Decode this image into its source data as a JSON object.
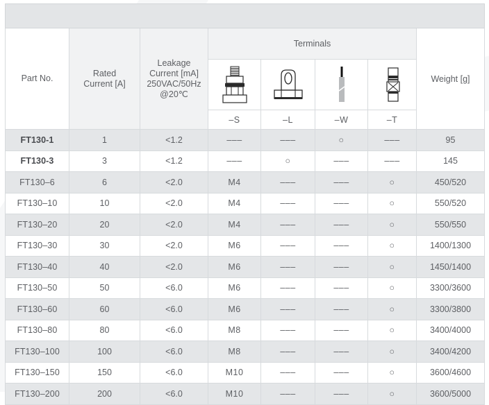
{
  "table": {
    "headers": {
      "part_no": "Part No.",
      "rated_current": "Rated\nCurrent [A]",
      "rated_current_line1": "Rated",
      "rated_current_line2": "Current [A]",
      "leakage_line1": "Leakage",
      "leakage_line2": "Current [mA]",
      "leakage_line3": "250VAC/50Hz",
      "leakage_line4": "@20℃",
      "terminals": "Terminals",
      "weight": "Weight [g]"
    },
    "terminal_types": [
      {
        "code": "–S",
        "icon": "screw-terminal-icon"
      },
      {
        "code": "–L",
        "icon": "lug-terminal-icon"
      },
      {
        "code": "–W",
        "icon": "wire-terminal-icon"
      },
      {
        "code": "–T",
        "icon": "tab-terminal-icon"
      }
    ],
    "rows": [
      {
        "part_no": "FT130-1",
        "bold": true,
        "rated_current": "1",
        "leakage": "<1.2",
        "s": "‒‒‒",
        "l": "‒‒‒",
        "w": "○",
        "t": "‒‒‒",
        "weight": "95"
      },
      {
        "part_no": "FT130-3",
        "bold": true,
        "rated_current": "3",
        "leakage": "<1.2",
        "s": "‒‒‒",
        "l": "○",
        "w": "‒‒‒",
        "t": "‒‒‒",
        "weight": "145"
      },
      {
        "part_no": "FT130–6",
        "bold": false,
        "rated_current": "6",
        "leakage": "<2.0",
        "s": "M4",
        "l": "‒‒‒",
        "w": "‒‒‒",
        "t": "○",
        "weight": "450/520"
      },
      {
        "part_no": "FT130–10",
        "bold": false,
        "rated_current": "10",
        "leakage": "<2.0",
        "s": "M4",
        "l": "‒‒‒",
        "w": "‒‒‒",
        "t": "○",
        "weight": "550/520"
      },
      {
        "part_no": "FT130–20",
        "bold": false,
        "rated_current": "20",
        "leakage": "<2.0",
        "s": "M4",
        "l": "‒‒‒",
        "w": "‒‒‒",
        "t": "○",
        "weight": "550/550"
      },
      {
        "part_no": "FT130–30",
        "bold": false,
        "rated_current": "30",
        "leakage": "<2.0",
        "s": "M6",
        "l": "‒‒‒",
        "w": "‒‒‒",
        "t": "○",
        "weight": "1400/1300"
      },
      {
        "part_no": "FT130–40",
        "bold": false,
        "rated_current": "40",
        "leakage": "<2.0",
        "s": "M6",
        "l": "‒‒‒",
        "w": "‒‒‒",
        "t": "○",
        "weight": "1450/1400"
      },
      {
        "part_no": "FT130–50",
        "bold": false,
        "rated_current": "50",
        "leakage": "<6.0",
        "s": "M6",
        "l": "‒‒‒",
        "w": "‒‒‒",
        "t": "○",
        "weight": "3300/3600"
      },
      {
        "part_no": "FT130–60",
        "bold": false,
        "rated_current": "60",
        "leakage": "<6.0",
        "s": "M6",
        "l": "‒‒‒",
        "w": "‒‒‒",
        "t": "○",
        "weight": "3300/3800"
      },
      {
        "part_no": "FT130–80",
        "bold": false,
        "rated_current": "80",
        "leakage": "<6.0",
        "s": "M8",
        "l": "‒‒‒",
        "w": "‒‒‒",
        "t": "○",
        "weight": "3400/4000"
      },
      {
        "part_no": "FT130–100",
        "bold": false,
        "rated_current": "100",
        "leakage": "<6.0",
        "s": "M8",
        "l": "‒‒‒",
        "w": "‒‒‒",
        "t": "○",
        "weight": "3400/4200"
      },
      {
        "part_no": "FT130–150",
        "bold": false,
        "rated_current": "150",
        "leakage": "<6.0",
        "s": "M10",
        "l": "‒‒‒",
        "w": "‒‒‒",
        "t": "○",
        "weight": "3600/4600"
      },
      {
        "part_no": "FT130–200",
        "bold": false,
        "rated_current": "200",
        "leakage": "<6.0",
        "s": "M10",
        "l": "‒‒‒",
        "w": "‒‒‒",
        "t": "○",
        "weight": "3600/5000"
      }
    ]
  },
  "colors": {
    "band": "#e3e5e7",
    "header_fill": "#f1f2f3",
    "row_odd": "#e4e6e8",
    "row_even": "#ffffff",
    "border": "#d7dadd",
    "text": "#5d5f63"
  }
}
